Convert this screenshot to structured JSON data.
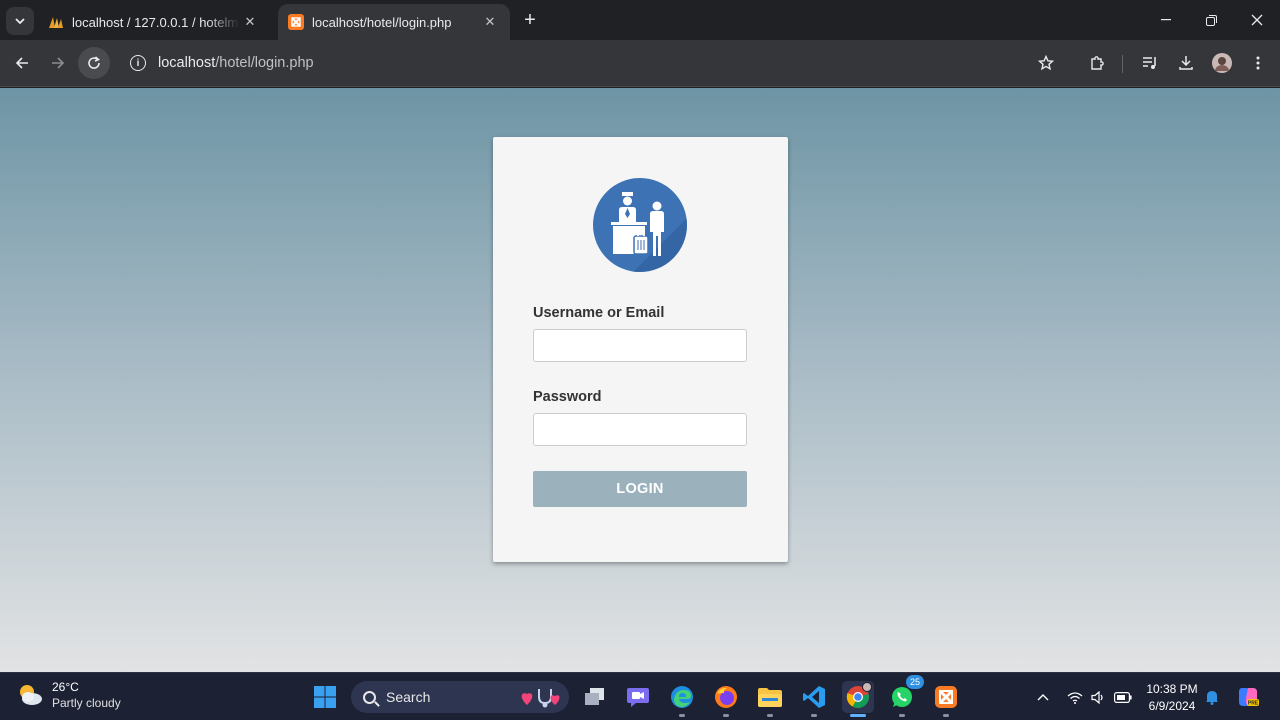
{
  "browser": {
    "tabs": [
      {
        "title": "localhost / 127.0.0.1 / hotelms /",
        "active": false
      },
      {
        "title": "localhost/hotel/login.php",
        "active": true
      }
    ],
    "url_host": "localhost",
    "url_path": "/hotel/login.php"
  },
  "login": {
    "username_label": "Username or Email",
    "username_value": "",
    "password_label": "Password",
    "password_value": "",
    "submit_label": "LOGIN"
  },
  "colors": {
    "accent_logo": "#3d72b4",
    "button_bg": "#9bb2bd"
  },
  "taskbar": {
    "weather_temp": "26°C",
    "weather_desc": "Partly cloudy",
    "search_placeholder": "Search",
    "whatsapp_badge": "25",
    "time": "10:38 PM",
    "date": "6/9/2024"
  }
}
